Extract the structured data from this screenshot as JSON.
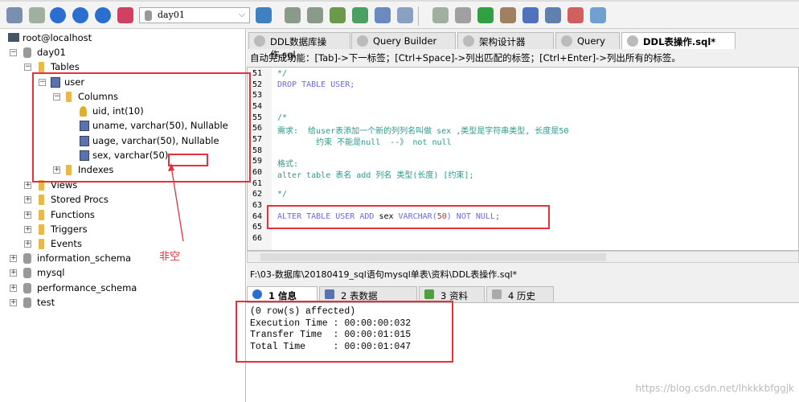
{
  "toolbar": {
    "database_selector": "day01",
    "icons": [
      "connect-icon",
      "new-connection-icon",
      "execute-icon",
      "execute-all-icon",
      "stop-icon",
      "schema-icon",
      "user-manager-icon",
      "backup-icon",
      "restore-icon",
      "import-icon",
      "export-icon",
      "table-data-icon",
      "table-keys-icon",
      "sql-formatter-icon",
      "schedule-icon",
      "sync-icon",
      "copy-database-icon",
      "query-builder-icon",
      "dashboard-icon",
      "table-diagram-icon",
      "schema-designer-icon"
    ]
  },
  "tree": {
    "connection": "root@localhost",
    "databases": [
      {
        "name": "day01"
      },
      {
        "name": "information_schema"
      },
      {
        "name": "mysql"
      },
      {
        "name": "performance_schema"
      },
      {
        "name": "test"
      }
    ],
    "day01": {
      "tables": "Tables",
      "table": "user",
      "columns_folder": "Columns",
      "columns": [
        "uid, int(10)",
        "uname, varchar(50), Nullable",
        "uage, varchar(50), Nullable",
        "sex, varchar(50)"
      ],
      "indexes": "Indexes",
      "folders": [
        "Views",
        "Stored Procs",
        "Functions",
        "Triggers",
        "Events"
      ]
    }
  },
  "tabs": [
    {
      "label": "DDL数据库操作.sql"
    },
    {
      "label": "Query Builder"
    },
    {
      "label": "架构设计器"
    },
    {
      "label": "Query"
    },
    {
      "label": "DDL表操作.sql*"
    }
  ],
  "hint": "自动完成功能：[Tab]->下一标签；[Ctrl+Space]->列出匹配的标签；[Ctrl+Enter]->列出所有的标签。",
  "editor": {
    "lines": [
      {
        "n": "51",
        "t": "*/",
        "c": "cm"
      },
      {
        "n": "52",
        "t": "DROP TABLE USER;",
        "c": "kw"
      },
      {
        "n": "53",
        "t": "",
        "c": "pl"
      },
      {
        "n": "54",
        "t": "",
        "c": "pl"
      },
      {
        "n": "55",
        "t": "/*",
        "c": "cm"
      },
      {
        "n": "56",
        "t": "需求:  给user表添加一个新的列列名叫做 sex ,类型是字符串类型, 长度是50",
        "c": "cm"
      },
      {
        "n": "57",
        "t": "        约束 不能是null  --》 not null",
        "c": "cm"
      },
      {
        "n": "58",
        "t": "",
        "c": "pl"
      },
      {
        "n": "59",
        "t": "格式:",
        "c": "cm"
      },
      {
        "n": "60",
        "t": "alter table 表名 add 列名 类型(长度) [约束];",
        "c": "cm"
      },
      {
        "n": "61",
        "t": "",
        "c": "pl"
      },
      {
        "n": "62",
        "t": "*/",
        "c": "cm"
      },
      {
        "n": "63",
        "t": "",
        "c": "pl"
      },
      {
        "n": "64",
        "t": "ALTER TABLE USER ADD sex VARCHAR(50) NOT NULL;",
        "c": "kw"
      },
      {
        "n": "65",
        "t": "",
        "c": "pl"
      },
      {
        "n": "66",
        "t": "",
        "c": "pl"
      }
    ]
  },
  "file_path": "F:\\03-数据库\\20180419_sql语句mysql单表\\资料\\DDL表操作.sql*",
  "result_tabs": [
    {
      "label": "1 信息"
    },
    {
      "label": "2 表数据"
    },
    {
      "label": "3 资料"
    },
    {
      "label": "4 历史"
    }
  ],
  "result": [
    "(0 row(s) affected)",
    "Execution Time : 00:00:00:032",
    "Transfer Time  : 00:00:01:015",
    "Total Time     : 00:00:01:047"
  ],
  "annotation": {
    "note": "非空",
    "color": "#e8303a"
  },
  "watermark": "https://blog.csdn.net/lhkkkbfggjk"
}
